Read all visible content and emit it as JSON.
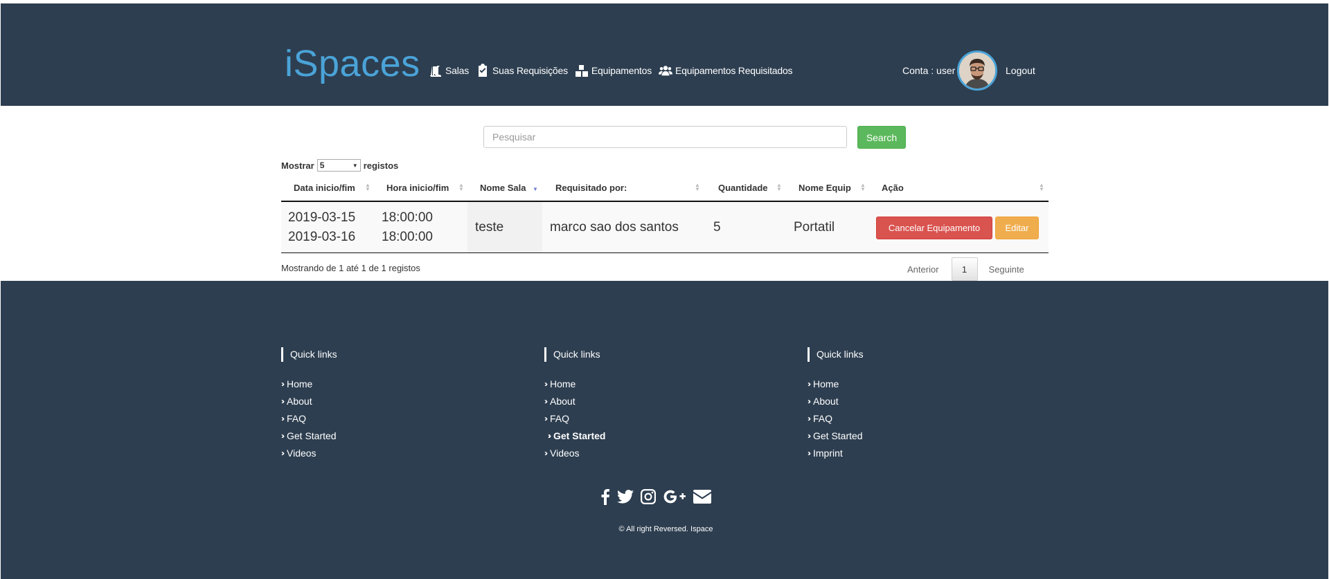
{
  "brand": "iSpaces",
  "nav": {
    "items": [
      {
        "label": "Salas",
        "icon": "door-icon"
      },
      {
        "label": "Suas Requisições",
        "icon": "clipboard-check-icon"
      },
      {
        "label": "Equipamentos",
        "icon": "boxes-icon"
      },
      {
        "label": "Equipamentos Requisitados",
        "icon": "users-icon"
      }
    ],
    "account_label": "Conta : user",
    "logout_label": "Logout"
  },
  "search": {
    "placeholder": "Pesquisar",
    "button_label": "Search"
  },
  "table_length": {
    "prefix": "Mostrar",
    "value": "5",
    "suffix": "registos"
  },
  "table": {
    "columns": [
      "Data inicio/fim",
      "Hora inicio/fim",
      "Nome Sala",
      "Requisitado por:",
      "Quantidade",
      "Nome Equip",
      "Ação"
    ],
    "rows": [
      {
        "date_start": "2019-03-15",
        "date_end": "2019-03-16",
        "time_start": "18:00:00",
        "time_end": "18:00:00",
        "room": "teste",
        "requested_by": "marco sao dos santos",
        "quantity": "5",
        "equipment": "Portatil",
        "cancel_label": "Cancelar Equipamento",
        "edit_label": "Editar"
      }
    ],
    "info": "Mostrando de 1 até 1 de 1 registos",
    "pagination": {
      "prev": "Anterior",
      "current": "1",
      "next": "Seguinte"
    }
  },
  "footer": {
    "columns": [
      {
        "title": "Quick links",
        "links": [
          "Home",
          "About",
          "FAQ",
          "Get Started",
          "Videos"
        ]
      },
      {
        "title": "Quick links",
        "links": [
          "Home",
          "About",
          "FAQ",
          "Get Started",
          "Videos"
        ]
      },
      {
        "title": "Quick links",
        "links": [
          "Home",
          "About",
          "FAQ",
          "Get Started",
          "Imprint"
        ]
      }
    ],
    "social": [
      "facebook-icon",
      "twitter-icon",
      "instagram-icon",
      "google-plus-icon",
      "envelope-icon"
    ],
    "copyright": "© All right Reversed.",
    "copyright_brand": "Ispace"
  },
  "colors": {
    "navbar_bg": "#2d3e50",
    "brand": "#4aa3d8",
    "search_button": "#5cb85c",
    "cancel_button": "#d9534f",
    "edit_button": "#f0ad4e"
  }
}
